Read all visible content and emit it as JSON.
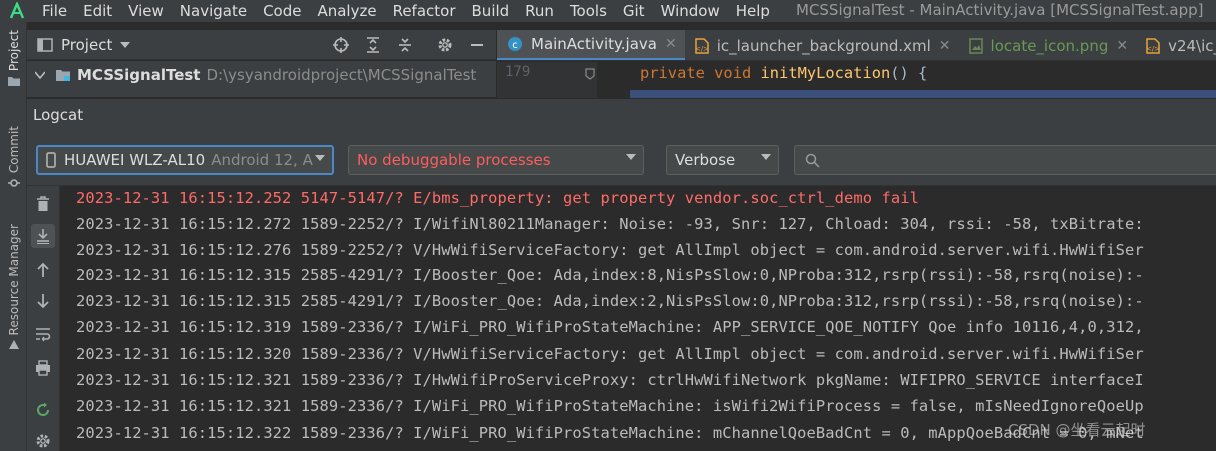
{
  "menubar": {
    "items": [
      "File",
      "Edit",
      "View",
      "Navigate",
      "Code",
      "Analyze",
      "Refactor",
      "Build",
      "Run",
      "Tools",
      "Git",
      "Window",
      "Help"
    ],
    "window_title": "MCSSignalTest - MainActivity.java [MCSSignalTest.app]"
  },
  "left_strip": {
    "project_label": "Project",
    "commit_label": "Commit",
    "resource_manager_label": "Resource Manager"
  },
  "project_panel": {
    "title": "Project",
    "root_name": "MCSSignalTest",
    "root_path": "D:\\ysyandroidproject\\MCSSignalTest"
  },
  "editor": {
    "tabs": [
      {
        "label": "MainActivity.java",
        "icon": "java-class-icon"
      },
      {
        "label": "ic_launcher_background.xml",
        "icon": "xml-file-icon"
      },
      {
        "label": "locate_icon.png",
        "icon": "image-file-icon"
      },
      {
        "label": "v24\\ic_",
        "icon": "xml-file-icon"
      }
    ],
    "line_number": "179",
    "code_keyword1": "private",
    "code_keyword2": "void",
    "code_method": "initMyLocation",
    "code_rest": "() {"
  },
  "logcat": {
    "title": "Logcat",
    "device_name": "HUAWEI WLZ-AL10",
    "device_version": "Android 12, A",
    "process_text": "No debuggable processes",
    "level": "Verbose",
    "search_value": "",
    "lines": [
      {
        "text": "2023-12-31 16:15:12.252 5147-5147/? E/bms_property: get property vendor.soc_ctrl_demo fail",
        "level": "error"
      },
      {
        "text": "2023-12-31 16:15:12.272 1589-2252/? I/WifiNl80211Manager: Noise: -93, Snr: 127, Chload: 304, rssi: -58, txBitrate:",
        "level": "info"
      },
      {
        "text": "2023-12-31 16:15:12.276 1589-2252/? V/HwWifiServiceFactory: get AllImpl object = com.android.server.wifi.HwWifiSer",
        "level": "verbose"
      },
      {
        "text": "2023-12-31 16:15:12.315 2585-4291/? I/Booster_Qoe: Ada,index:8,NisPsSlow:0,NProba:312,rsrp(rssi):-58,rsrq(noise):-",
        "level": "info"
      },
      {
        "text": "2023-12-31 16:15:12.315 2585-4291/? I/Booster_Qoe: Ada,index:2,NisPsSlow:0,NProba:312,rsrp(rssi):-58,rsrq(noise):-",
        "level": "info"
      },
      {
        "text": "2023-12-31 16:15:12.319 1589-2336/? I/WiFi_PRO_WifiProStateMachine: APP_SERVICE_QOE_NOTIFY Qoe info 10116,4,0,312,",
        "level": "info"
      },
      {
        "text": "2023-12-31 16:15:12.320 1589-2336/? V/HwWifiServiceFactory: get AllImpl object = com.android.server.wifi.HwWifiSer",
        "level": "verbose"
      },
      {
        "text": "2023-12-31 16:15:12.321 1589-2336/? I/HwWifiProServiceProxy: ctrlHwWifiNetwork pkgName: WIFIPRO_SERVICE interfaceI",
        "level": "info"
      },
      {
        "text": "2023-12-31 16:15:12.321 1589-2336/? I/WiFi_PRO_WifiProStateMachine: isWifi2WifiProcess = false, mIsNeedIgnoreQoeUp",
        "level": "info"
      },
      {
        "text": "2023-12-31 16:15:12.322 1589-2336/? I/WiFi_PRO_WifiProStateMachine: mChannelQoeBadCnt = 0, mAppQoeBadCnt = 0, mNet",
        "level": "info"
      }
    ]
  },
  "watermark": "CSDN @坐看云起时",
  "colors": {
    "error": "#ff6b68",
    "accent": "#4a88c7",
    "keyword": "#cc7832",
    "method": "#ffc66d",
    "process_warning": "#ff5c5c",
    "success_green": "#59a869"
  }
}
